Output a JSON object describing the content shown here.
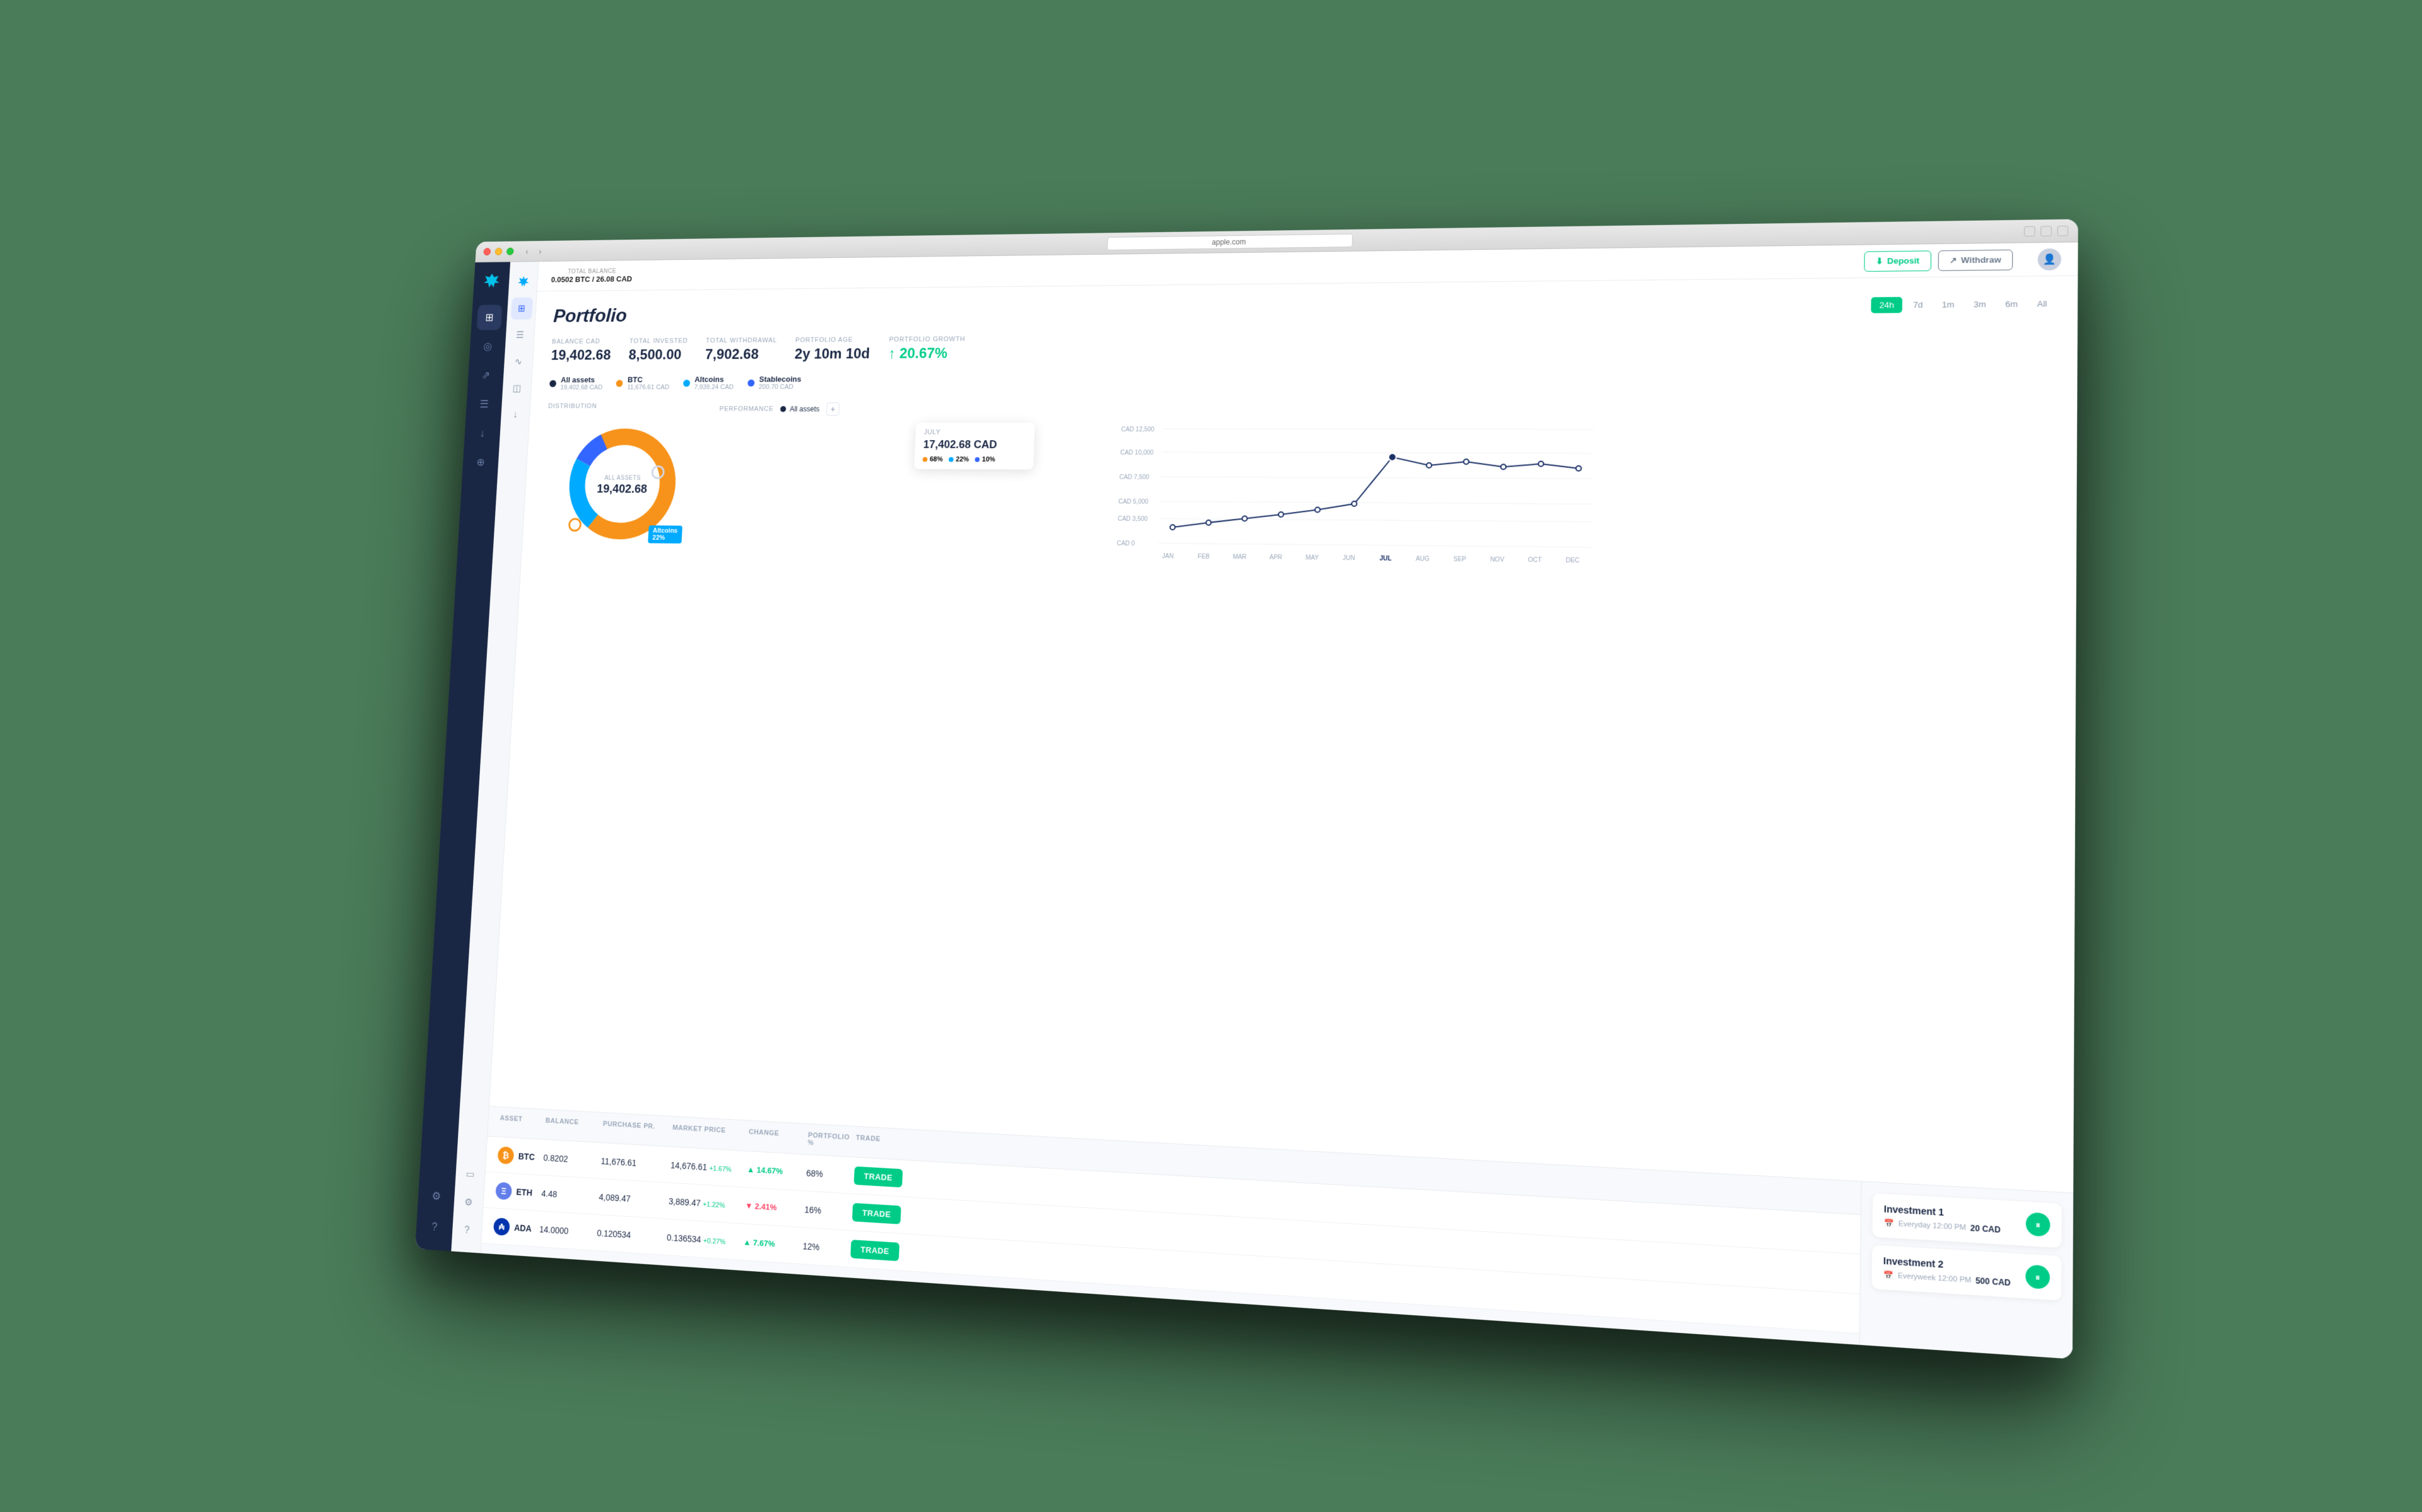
{
  "browser": {
    "url": "apple.com",
    "balance_label": "TOTAL BALANCE",
    "balance_value": "0.0502 BTC / 26.08 CAD",
    "deposit_label": "Deposit",
    "withdraw_label": "Withdraw"
  },
  "sidebar": {
    "items": [
      {
        "id": "dashboard",
        "icon": "⊞",
        "active": true
      },
      {
        "id": "analytics",
        "icon": "◉",
        "active": false
      },
      {
        "id": "share",
        "icon": "↗",
        "active": false
      },
      {
        "id": "transactions",
        "icon": "≡",
        "active": false
      },
      {
        "id": "download",
        "icon": "↓",
        "active": false
      },
      {
        "id": "share2",
        "icon": "⊕",
        "active": false
      },
      {
        "id": "settings",
        "icon": "⚙",
        "active": false
      },
      {
        "id": "help",
        "icon": "?",
        "active": false
      }
    ]
  },
  "inner_sidebar": {
    "items": [
      {
        "id": "grid",
        "icon": "⊞",
        "active": true
      },
      {
        "id": "list",
        "icon": "≡",
        "active": false
      },
      {
        "id": "trend",
        "icon": "∿",
        "active": false
      },
      {
        "id": "chart",
        "icon": "◫",
        "active": false
      },
      {
        "id": "download2",
        "icon": "↓",
        "active": false
      },
      {
        "id": "monitor",
        "icon": "▭",
        "active": false
      },
      {
        "id": "settings2",
        "icon": "⚙",
        "active": false
      },
      {
        "id": "help2",
        "icon": "?",
        "active": false
      }
    ]
  },
  "portfolio": {
    "title": "Portfolio",
    "time_tabs": [
      {
        "label": "24h",
        "active": true
      },
      {
        "label": "7d",
        "active": false
      },
      {
        "label": "1m",
        "active": false
      },
      {
        "label": "3m",
        "active": false
      },
      {
        "label": "6m",
        "active": false
      },
      {
        "label": "All",
        "active": false
      }
    ],
    "stats": {
      "balance_cad_label": "BALANCE CAD",
      "balance_cad": "19,402.68",
      "total_invested_label": "TOTAL INVESTED",
      "total_invested": "8,500.00",
      "total_withdrawal_label": "TOTAL WITHDRAWAL",
      "total_withdrawal": "7,902.68",
      "portfolio_age_label": "PORTFOLIO AGE",
      "portfolio_age": "2y 10m 10d",
      "portfolio_growth_label": "PORTFOLIO GROWTH",
      "portfolio_growth": "↑ 20.67%"
    },
    "legend": [
      {
        "name": "All assets",
        "amount": "19,402.68 CAD",
        "color": "#1a2744"
      },
      {
        "name": "BTC",
        "amount": "11,676.61 CAD",
        "color": "#f7931a"
      },
      {
        "name": "Altcoins",
        "amount": "7,939.24 CAD",
        "color": "#00aaff"
      },
      {
        "name": "Stablecoins",
        "amount": "200.70 CAD",
        "color": "#3366ff"
      }
    ],
    "distribution_label": "DISTRIBUTION",
    "donut": {
      "center_label": "ALL ASSETS",
      "center_value": "19,402.68",
      "altcoins_label": "Altcoins",
      "altcoins_pct": "22%"
    },
    "performance_label": "PERFORMANCE",
    "performance_legend": "All assets",
    "chart": {
      "y_labels": [
        "CAD 12,500",
        "CAD 10,000",
        "CAD 7,500",
        "CAD 5,000",
        "CAD 3,500",
        "CAD 0"
      ],
      "x_labels": [
        "JAN",
        "FEB",
        "MAR",
        "APR",
        "MAY",
        "JUN",
        "JUL",
        "AUG",
        "SEP",
        "NOV",
        "OCT",
        "DEC"
      ],
      "tooltip": {
        "month": "JULY",
        "value": "17,402.68 CAD",
        "btc_pct": "68%",
        "alt_pct": "22%",
        "stable_pct": "10%"
      }
    }
  },
  "table": {
    "headers": [
      "ASSET",
      "BALANCE",
      "PURCHASE PR.",
      "MARKET PRICE",
      "CHANGE",
      "PORTFOLIO %",
      "TRADE"
    ],
    "rows": [
      {
        "asset": "BTC",
        "icon_class": "btc",
        "balance": "0.8202",
        "purchase_price": "11,676.61",
        "market_price": "14,676.61",
        "market_change_pct": "+1.67%",
        "change": "▲ 14.67%",
        "change_type": "up",
        "portfolio_pct": "68%",
        "trade_label": "TRADE"
      },
      {
        "asset": "ETH",
        "icon_class": "eth",
        "balance": "4.48",
        "purchase_price": "4,089.47",
        "market_price": "3,889.47",
        "market_change_pct": "+1.22%",
        "change": "▼ 2.41%",
        "change_type": "down",
        "portfolio_pct": "16%",
        "trade_label": "TRADE"
      },
      {
        "asset": "ADA",
        "icon_class": "ada",
        "balance": "14.0000",
        "purchase_price": "0.120534",
        "market_price": "0.136534",
        "market_change_pct": "+0.27%",
        "change": "▲ 7.67%",
        "change_type": "up",
        "portfolio_pct": "12%",
        "trade_label": "TRADE"
      }
    ]
  },
  "investments": [
    {
      "name": "Investment 1",
      "schedule": "Everyday 12:00 PM",
      "amount": "20 CAD",
      "pause_label": "⏸"
    },
    {
      "name": "Investment 2",
      "schedule": "Everyweek 12:00 PM",
      "amount": "500 CAD",
      "pause_label": "⏸"
    }
  ]
}
